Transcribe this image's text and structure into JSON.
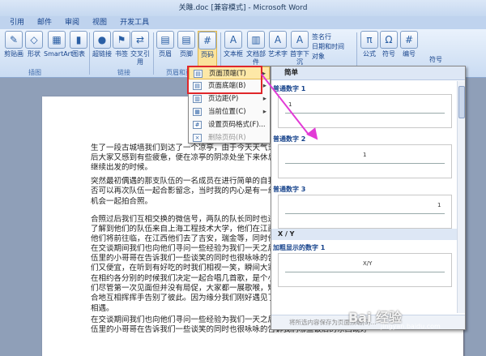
{
  "window": {
    "title": "关雎.doc [兼容模式] - Microsoft Word"
  },
  "tabs": [
    "引用",
    "邮件",
    "审阅",
    "视图",
    "开发工具"
  ],
  "ribbon": {
    "buttons": [
      {
        "label": "剪贴画",
        "icon": "clipart-icon"
      },
      {
        "label": "形状",
        "icon": "shapes-icon"
      },
      {
        "label": "SmartArt",
        "icon": "smartart-icon"
      },
      {
        "label": "图表",
        "icon": "chart-icon"
      },
      {
        "label": "超链接",
        "icon": "hyperlink-icon"
      },
      {
        "label": "书签",
        "icon": "bookmark-icon"
      },
      {
        "label": "交叉引用",
        "icon": "crossref-icon"
      },
      {
        "label": "页眉",
        "icon": "header-icon"
      },
      {
        "label": "页脚",
        "icon": "footer-icon"
      },
      {
        "label": "页码",
        "icon": "pagenumber-icon"
      },
      {
        "label": "文本框",
        "icon": "textbox-icon"
      },
      {
        "label": "文档部件",
        "icon": "quickparts-icon"
      },
      {
        "label": "艺术字",
        "icon": "wordart-icon"
      },
      {
        "label": "首字下沉",
        "icon": "dropcap-icon"
      },
      {
        "label": "公式",
        "icon": "equation-icon"
      },
      {
        "label": "符号",
        "icon": "symbol-icon"
      },
      {
        "label": "编号",
        "icon": "number-icon"
      }
    ],
    "small": [
      "签名行",
      "日期和时间",
      "对象",
      "符号"
    ],
    "groups": [
      "插图",
      "链接",
      "页眉和页脚"
    ]
  },
  "menu": {
    "items": [
      {
        "label": "页面顶端(T)",
        "icon": "page-top-icon",
        "arrow": "▸"
      },
      {
        "label": "页面底端(B)",
        "icon": "page-bottom-icon",
        "arrow": "▸"
      },
      {
        "label": "页边距(P)",
        "icon": "page-margin-icon",
        "arrow": "▸"
      },
      {
        "label": "当前位置(C)",
        "icon": "current-pos-icon",
        "arrow": "▸"
      },
      {
        "label": "设置页码格式(F)...",
        "icon": "format-icon",
        "arrow": ""
      },
      {
        "label": "删除页码(R)",
        "icon": "delete-icon",
        "arrow": ""
      }
    ]
  },
  "gallery": {
    "head": "简单",
    "items": [
      {
        "label": "普通数字 1",
        "num": "1"
      },
      {
        "label": "普通数字 2",
        "num": "1"
      },
      {
        "label": "普通数字 3",
        "num": "1"
      },
      {
        "label": "加粗显示的数字 1",
        "num": "X/Y"
      }
    ],
    "section": "X / Y",
    "foot": "将所选内容保存为页面顶端(S)..."
  },
  "document": {
    "paragraphs": [
      "生了一段古城墙我们到达了一个凉亭，由于今天天气炎热",
      "后大家又感到有些疲惫，便在凉亭的阴凉处坐下来休息，在我",
      "继续出发的时候。",
      "突然最初偶遇的那支队伍的一名成员在进行简单的自我介",
      "否可以再次队伍一起合影留念，当时我的内心是有一丝惊讶，",
      "机会一起拍合照。",
      "合照过后我们互相交换的微信号，两队的队长同时也进行",
      "了解到他们的队伍来自上海工程技术大学，他们在江西已经",
      "他们将前往临，在江西他们去了吉安，瑞金等，同时他们也",
      "在交谈期间我们也向他们寻问一些经验为我们一天之后的",
      "伍里的小哥哥在告诉我们一些谈笑的同时也很咏咏的告诉我们",
      "们又便宜，在听到有好吃的时我们相视一笑，瞬间大家的气",
      "在相约各分别的时候我们决定一起合唱几首歌，是个小插曲",
      "们尽管第一次见面但并没有局促，大家都一展歌喉，短暂的交",
      "合地互相挥挥手告别了彼此。因为缘分我们刚好遇见了他们，",
      "相遇。",
      "在交谈期间我们也向他们寻问一些经验为我们一天之后的调研做准备，他们队",
      "伍里的小哥哥在告诉我们一些谈笑的同时也很咏咏的告诉我们哪些饭店的东西既好"
    ]
  },
  "watermark": {
    "text": "Bai 经验",
    "sub": "jingyan.baidu.com"
  }
}
